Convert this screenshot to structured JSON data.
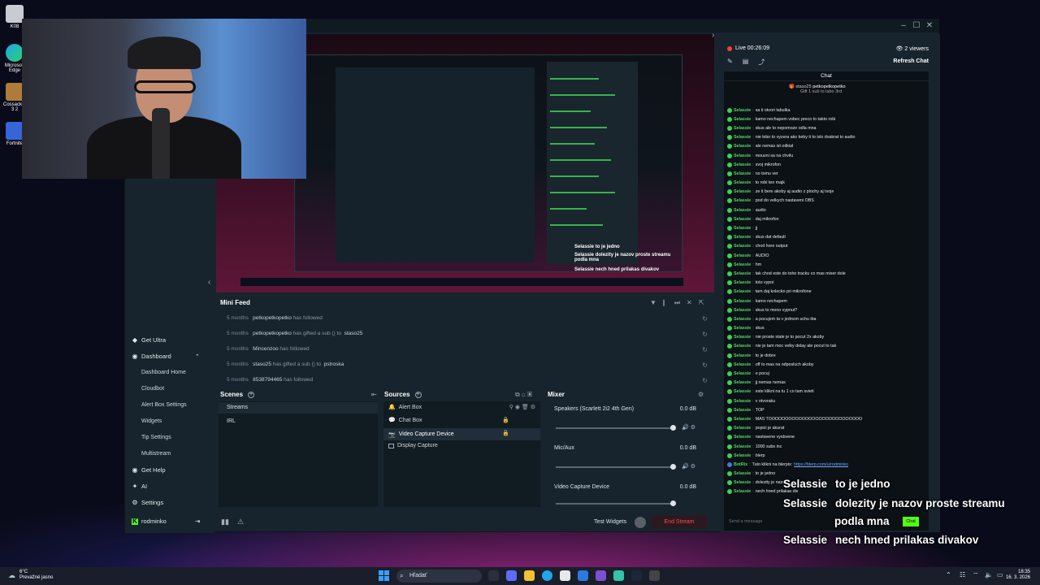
{
  "desktop": {
    "icons": [
      "K08",
      "Microsoft Edge",
      "Cossacks-3 2",
      "Fortnite"
    ]
  },
  "window_controls": [
    "–",
    "☐",
    "✕"
  ],
  "sidenav": {
    "get_ultra": "Get Ultra",
    "dashboard": "Dashboard",
    "items": [
      "Dashboard Home",
      "Cloudbot",
      "Alert Box Settings",
      "Widgets",
      "Tip Settings",
      "Multistream"
    ],
    "get_help": "Get Help",
    "ai": "AI",
    "settings": "Settings",
    "user": "rodminko"
  },
  "preview_overlay": {
    "user": "Selassie",
    "lines": [
      "to je jedno",
      "dolezity je nazov proste streamu podla mna",
      "nech hned prilakas divakov"
    ]
  },
  "minifeed": {
    "title": "Mini Feed",
    "rows": [
      {
        "time": "5 months",
        "who": "petkopetkopetko",
        "action": "has followed",
        "target": ""
      },
      {
        "time": "5 months",
        "who": "petkopetkopetko",
        "action": "has gifted a sub () to",
        "target": "staso25"
      },
      {
        "time": "5 months",
        "who": "Mincenzoo",
        "action": "has followed",
        "target": ""
      },
      {
        "time": "5 months",
        "who": "staso25",
        "action": "has gifted a sub () to",
        "target": "pstroska"
      },
      {
        "time": "5 months",
        "who": "8538794465",
        "action": "has followed",
        "target": ""
      }
    ]
  },
  "scenes": {
    "title": "Scenes",
    "items": [
      "Streams",
      "IRL"
    ]
  },
  "sources": {
    "title": "Sources",
    "items": [
      "Alert Box",
      "Chat Box",
      "Video Capture Device",
      "Display Capture"
    ]
  },
  "mixer": {
    "title": "Mixer",
    "channels": [
      {
        "name": "Speakers (Scarlett 2i2 4th Gen)",
        "db": "0.0 dB"
      },
      {
        "name": "Mic/Aux",
        "db": "0.0 dB"
      },
      {
        "name": "Video Capture Device",
        "db": "0.0 dB"
      }
    ]
  },
  "bottombar": {
    "test_widgets": "Test Widgets",
    "end_stream": "End Stream"
  },
  "chat": {
    "live": "Live 00:26:09",
    "viewers": "2 viewers",
    "refresh": "Refresh Chat",
    "title": "Chat",
    "pinned_user1": "staso25",
    "pinned_user2": "petkopetkopetko",
    "pinned_text": "Gift 1 sub to labo 3rd",
    "messages": [
      {
        "user": "Selassie",
        "text": "sa ti otvori tabulka"
      },
      {
        "user": "Selassie",
        "text": "kamo nechapem vobec preco to takto robi"
      },
      {
        "user": "Selassie",
        "text": "skus ale to nepomoze odla mna"
      },
      {
        "user": "Selassie",
        "text": "nie lebo to vyzera ako keby ti to islo dvakrat to audio"
      },
      {
        "user": "Selassie",
        "text": "ale nemas ist odkial"
      },
      {
        "user": "Selassie",
        "text": "mouzni sa na chvilu"
      },
      {
        "user": "Selassie",
        "text": "svoj mikrofon"
      },
      {
        "user": "Selassie",
        "text": "no tomu ver"
      },
      {
        "user": "Selassie",
        "text": "to robi ten majk"
      },
      {
        "user": "Selassie",
        "text": "ze ti bere akoby aj audio z plochy aj tvoje"
      },
      {
        "user": "Selassie",
        "text": "pod do velkych nastaveni OBS"
      },
      {
        "user": "Selassie",
        "text": "audio"
      },
      {
        "user": "Selassie",
        "text": "daj mikrofon"
      },
      {
        "user": "Selassie",
        "text": "jj"
      },
      {
        "user": "Selassie",
        "text": "skus dat default"
      },
      {
        "user": "Selassie",
        "text": "chod hore output"
      },
      {
        "user": "Selassie",
        "text": "AUDIO"
      },
      {
        "user": "Selassie",
        "text": "hm"
      },
      {
        "user": "Selassie",
        "text": "tak chod este do toho tracku co mas mixer dole"
      },
      {
        "user": "Selassie",
        "text": "toto vypni"
      },
      {
        "user": "Selassie",
        "text": "tam daj kolecko pri mikrofone"
      },
      {
        "user": "Selassie",
        "text": "kamo nechapem"
      },
      {
        "user": "Selassie",
        "text": "skus to mono vypnut?"
      },
      {
        "user": "Selassie",
        "text": "a pocujem ta v jednom uchu iba"
      },
      {
        "user": "Selassie",
        "text": "skus"
      },
      {
        "user": "Selassie",
        "text": "nie proste stale je to pocut 2x akoby"
      },
      {
        "user": "Selassie",
        "text": "nie je tam moc velky delay ale pocut to tak"
      },
      {
        "user": "Selassie",
        "text": "to je dobre"
      },
      {
        "user": "Selassie",
        "text": "off to mas na odposluch akoby"
      },
      {
        "user": "Selassie",
        "text": "e pocuj"
      },
      {
        "user": "Selassie",
        "text": "jj nemas nemas"
      },
      {
        "user": "Selassie",
        "text": "este klikni na tu 1 co tam svieti"
      },
      {
        "user": "Selassie",
        "text": "v otvoraku"
      },
      {
        "user": "Selassie",
        "text": "TOP"
      },
      {
        "user": "Selassie",
        "text": "MAS TOOOOOOOOOOOOOOOOOOOOOOOOOOOO"
      },
      {
        "user": "Selassie",
        "text": "popici je akurat"
      },
      {
        "user": "Selassie",
        "text": "nastavene vysbvene"
      },
      {
        "user": "Selassie",
        "text": "1000 subs inc"
      },
      {
        "user": "Selassie",
        "text": "blerp"
      },
      {
        "user": "BotRix",
        "text": "Tuto klikni na blerpix:",
        "link": "https://blerp.com/u/rodminko"
      },
      {
        "user": "Selassie",
        "text": "to je jedno"
      },
      {
        "user": "Selassie",
        "text": "dolezity je nazov"
      },
      {
        "user": "Selassie",
        "text": "nech hned prilakas div"
      }
    ],
    "send_placeholder": "Send a message",
    "chat_button": "Chat"
  },
  "stream_overlay": {
    "lines": [
      {
        "user": "Selassie",
        "text": "to je jedno"
      },
      {
        "user": "Selassie",
        "text": "dolezity je nazov proste streamu"
      },
      {
        "user": "",
        "text": "podla mna"
      },
      {
        "user": "Selassie",
        "text": "nech hned prilakas divakov"
      }
    ]
  },
  "taskbar": {
    "weather_temp": "6°C",
    "weather_desc": "Prevažné jasno",
    "search": "Hľadať",
    "time": "18:35",
    "date": "16. 3. 2026"
  },
  "colors": {
    "accent": "#53fc18",
    "live": "#ff3b3b",
    "end_stream": "#ff4b4b",
    "chat_user": "#54d46a"
  }
}
